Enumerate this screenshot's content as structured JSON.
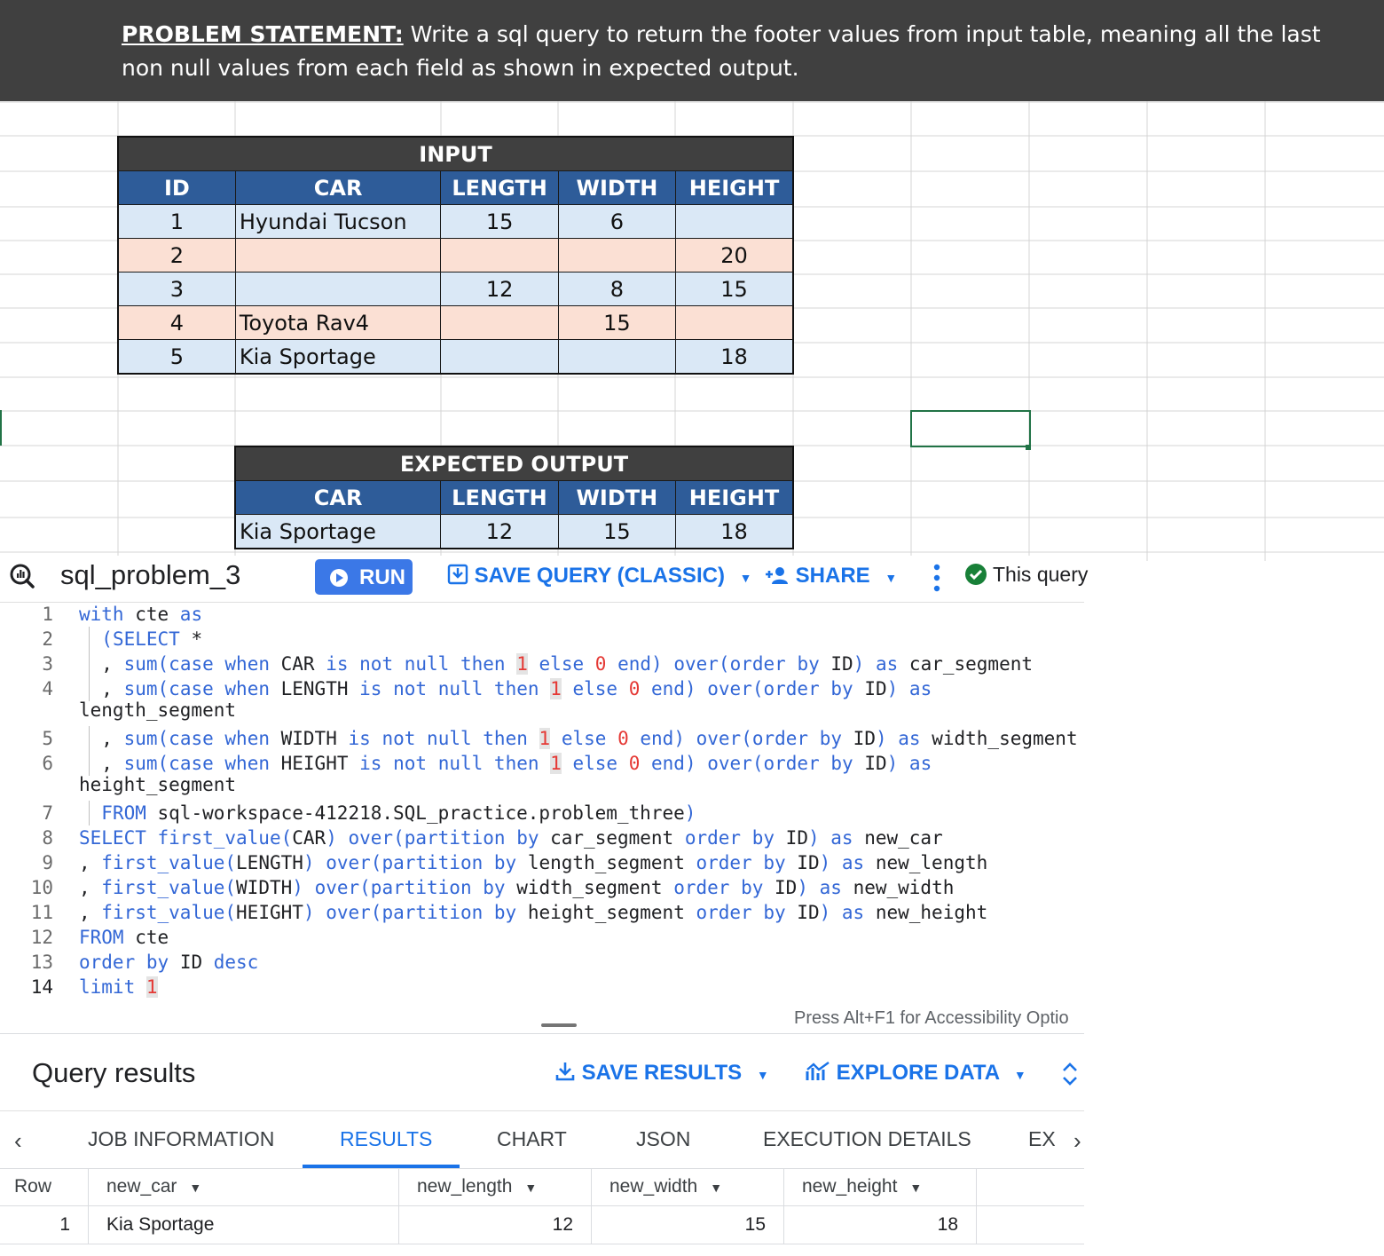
{
  "problem": {
    "label": "PROBLEM STATEMENT:",
    "text": " Write a sql query to return the footer values from input table, meaning all the last non null values from each field as shown in expected output."
  },
  "input_table": {
    "title": "INPUT",
    "headers": [
      "ID",
      "CAR",
      "LENGTH",
      "WIDTH",
      "HEIGHT"
    ],
    "rows": [
      [
        "1",
        "Hyundai Tucson",
        "15",
        "6",
        ""
      ],
      [
        "2",
        "",
        "",
        "",
        "20"
      ],
      [
        "3",
        "",
        "12",
        "8",
        "15"
      ],
      [
        "4",
        "Toyota Rav4",
        "",
        "15",
        ""
      ],
      [
        "5",
        "Kia Sportage",
        "",
        "",
        "18"
      ]
    ]
  },
  "output_table": {
    "title": "EXPECTED OUTPUT",
    "headers": [
      "CAR",
      "LENGTH",
      "WIDTH",
      "HEIGHT"
    ],
    "rows": [
      [
        "Kia Sportage",
        "12",
        "15",
        "18"
      ]
    ]
  },
  "toolbar": {
    "title": "sql_problem_3",
    "run": "RUN",
    "save_query": "SAVE QUERY (CLASSIC)",
    "share": "SHARE",
    "status": "This query"
  },
  "editor": {
    "line_numbers": [
      "1",
      "2",
      "3",
      "4",
      "5",
      "6",
      "7",
      "8",
      "9",
      "10",
      "11",
      "12",
      "13",
      "14"
    ],
    "lines": [
      "with cte as",
      "(SELECT *",
      ", sum(case when CAR is not null then 1 else 0 end) over(order by ID) as car_segment",
      ", sum(case when LENGTH is not null then 1 else 0 end) over(order by ID) as length_segment",
      ", sum(case when WIDTH is not null then 1 else 0 end) over(order by ID) as width_segment",
      ", sum(case when HEIGHT is not null then 1 else 0 end) over(order by ID) as height_segment",
      "FROM sql-workspace-412218.SQL_practice.problem_three)",
      "SELECT first_value(CAR) over(partition by car_segment order by ID) as new_car",
      ", first_value(LENGTH) over(partition by length_segment order by ID) as new_length",
      ", first_value(WIDTH) over(partition by width_segment order by ID) as new_width",
      ", first_value(HEIGHT) over(partition by height_segment order by ID) as new_height",
      "FROM cte",
      "order by ID desc",
      "limit 1"
    ],
    "accessibility_hint": "Press Alt+F1 for Accessibility Optio"
  },
  "results": {
    "title": "Query results",
    "save_results": "SAVE RESULTS",
    "explore_data": "EXPLORE DATA",
    "tabs": [
      "JOB INFORMATION",
      "RESULTS",
      "CHART",
      "JSON",
      "EXECUTION DETAILS",
      "EX"
    ],
    "active_tab": "RESULTS",
    "columns": [
      "Row",
      "new_car",
      "new_length",
      "new_width",
      "new_height"
    ],
    "rows": [
      [
        "1",
        "Kia Sportage",
        "12",
        "15",
        "18"
      ]
    ]
  },
  "colors": {
    "banner": "#404040",
    "table_header": "#2e5c99",
    "row_blue": "#dae8f6",
    "row_peach": "#fbe0d4",
    "accent": "#1a73e8",
    "run_button": "#3b78e7",
    "sql_keyword": "#3367d6",
    "sql_number": "#e53935",
    "selection": "#217346"
  }
}
